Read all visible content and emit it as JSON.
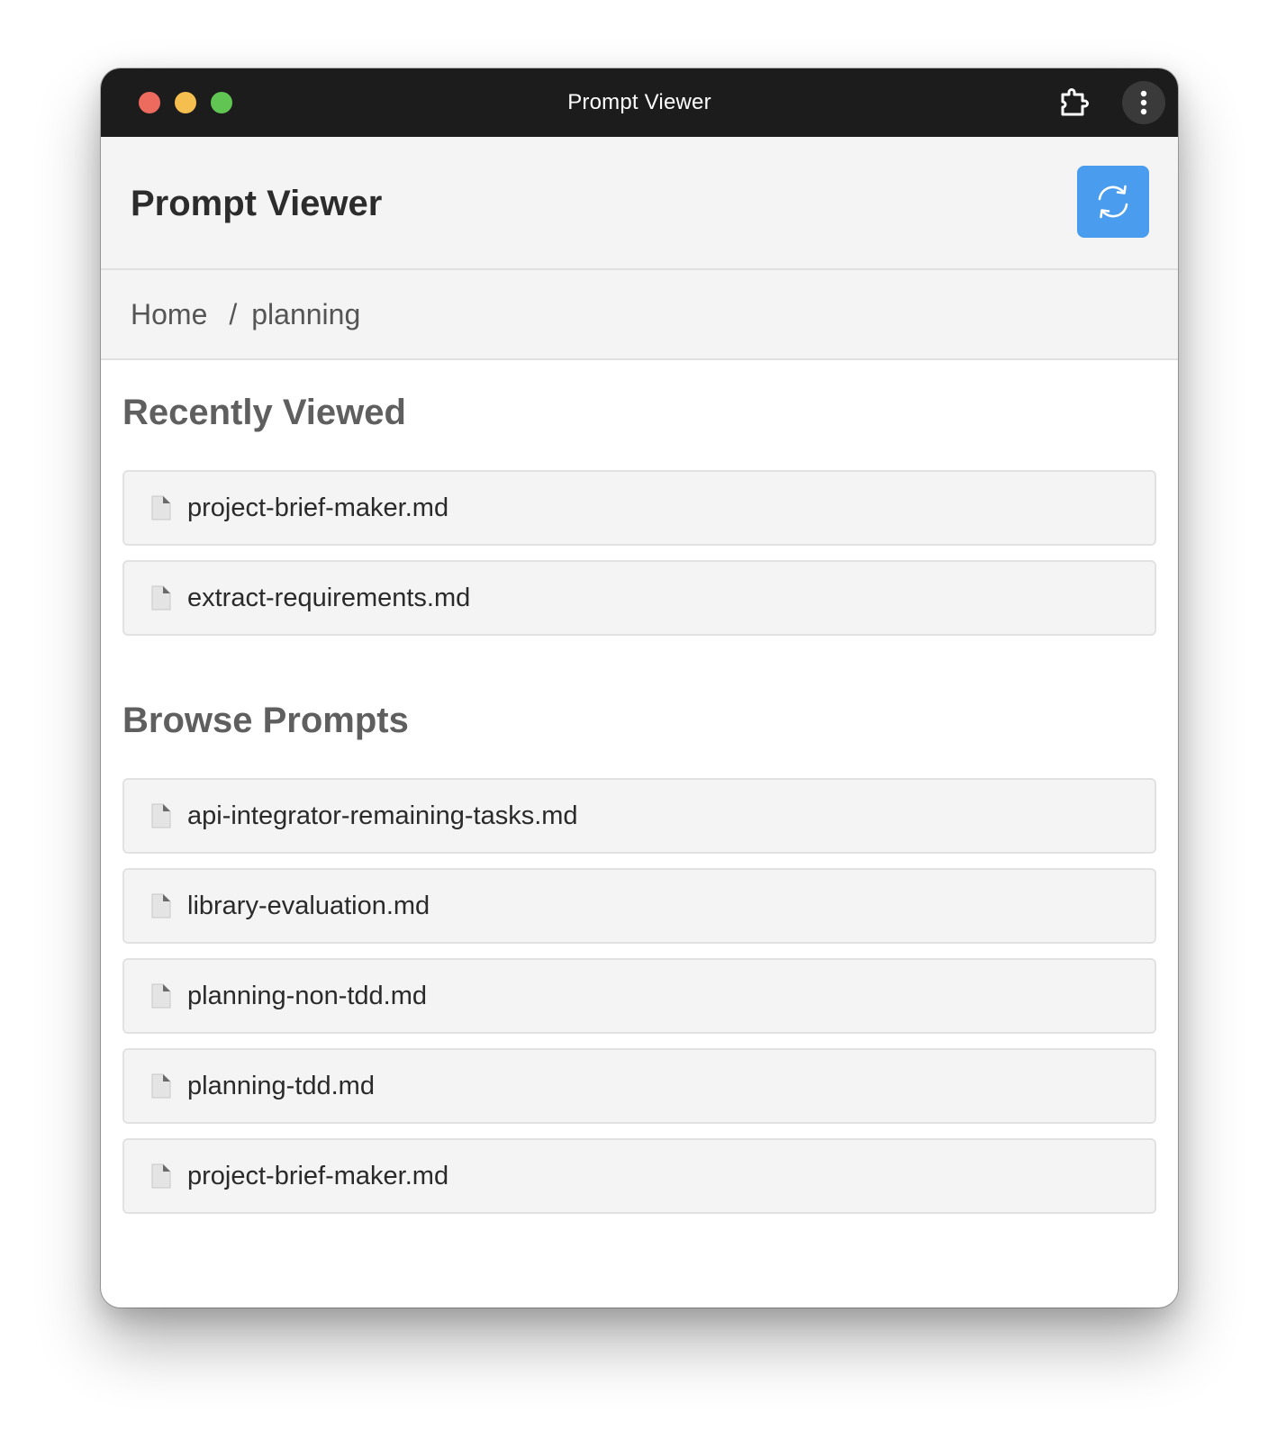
{
  "window": {
    "title": "Prompt Viewer"
  },
  "header": {
    "title": "Prompt Viewer",
    "refresh_icon": "refresh-icon",
    "accent": "#4a9cef"
  },
  "breadcrumb": {
    "home": "Home",
    "separator": "/",
    "current": "planning"
  },
  "recent": {
    "title": "Recently Viewed",
    "items": [
      {
        "label": "project-brief-maker.md",
        "icon": "file-icon"
      },
      {
        "label": "extract-requirements.md",
        "icon": "file-icon"
      }
    ]
  },
  "browse": {
    "title": "Browse Prompts",
    "items": [
      {
        "label": "api-integrator-remaining-tasks.md",
        "icon": "file-icon"
      },
      {
        "label": "library-evaluation.md",
        "icon": "file-icon"
      },
      {
        "label": "planning-non-tdd.md",
        "icon": "file-icon"
      },
      {
        "label": "planning-tdd.md",
        "icon": "file-icon"
      },
      {
        "label": "project-brief-maker.md",
        "icon": "file-icon"
      }
    ]
  }
}
